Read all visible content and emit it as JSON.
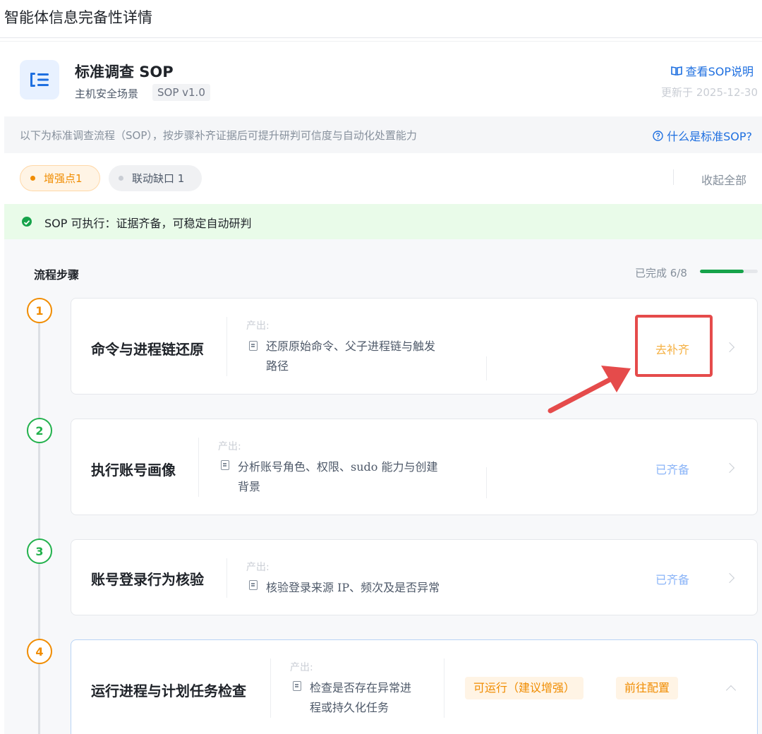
{
  "page": {
    "title": "智能体信息完备性详情"
  },
  "sop": {
    "title": "标准调查 SOP",
    "scene": "主机安全场景",
    "version": "SOP v1.0",
    "view_link": "查看SOP说明",
    "updated": "更新于 2025-12-30"
  },
  "info": {
    "text": "以下为标准调查流程（SOP），按步骤补齐证据后可提升研判可信度与自动化处置能力",
    "link": "什么是标准SOP?"
  },
  "filters": {
    "enhance": "增强点1",
    "gap": "联动缺口 1",
    "collapse_all": "收起全部"
  },
  "banner": {
    "text": "SOP 可执行：证据齐备，可稳定自动研判"
  },
  "steps_section": {
    "heading": "流程步骤",
    "progress_label": "已完成 6/8",
    "progress_fraction": 0.75
  },
  "steps": [
    {
      "num": "1",
      "title": "命令与进程链还原",
      "output_label": "产出:",
      "output_line1": "还原原始命令、父子进程链与触发",
      "output_line2": "路径",
      "status": "去补齐"
    },
    {
      "num": "2",
      "title": "执行账号画像",
      "output_label": "产出:",
      "output_line1": "分析账号角色、权限、sudo 能力与创建",
      "output_line2": "背景",
      "status": "已齐备"
    },
    {
      "num": "3",
      "title": "账号登录行为核验",
      "output_label": "产出:",
      "output_line1": "核验登录来源 IP、频次及是否异常",
      "status": "已齐备"
    },
    {
      "num": "4",
      "title": "运行进程与计划任务检查",
      "output_label": "产出:",
      "output_line1": "检查是否存在异常进",
      "output_line2": "程或持久化任务",
      "runnable": "可运行（建议增强）",
      "configure": "前往配置"
    }
  ],
  "colors": {
    "accent_blue": "#1e6fe0",
    "warning_orange": "#f08c00",
    "success_green": "#16a34a",
    "annotation_red": "#e54b4b"
  }
}
